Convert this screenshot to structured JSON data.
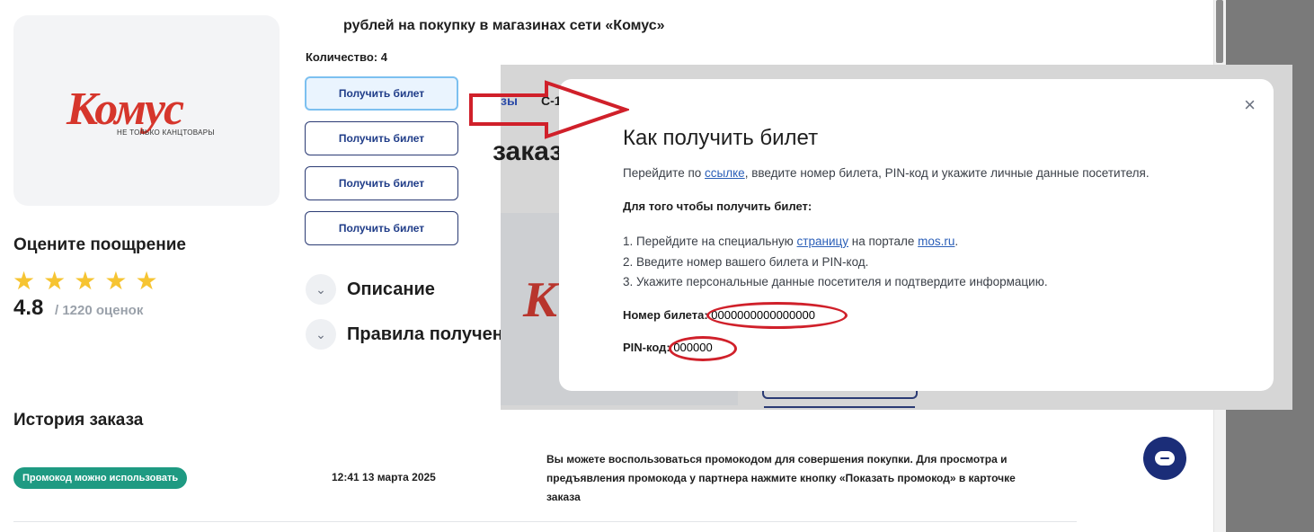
{
  "brand": {
    "logo_word": "Комус",
    "logo_tagline": "НЕ ТОЛЬКО КАНЦТОВАРЫ",
    "color": "#d6362c"
  },
  "headline": "рублей на покупку в магазинах сети «Комус»",
  "quantity_label": "Количество: 4",
  "ticket_buttons": [
    "Получить билет",
    "Получить билет",
    "Получить билет",
    "Получить билет"
  ],
  "rating": {
    "title": "Оцените поощрение",
    "value": "4.8",
    "count": "/ 1220 оценок",
    "stars": 5
  },
  "sections": {
    "description": "Описание",
    "rules": "Правила получен"
  },
  "history": {
    "title": "История заказа",
    "badge": "Промокод можно использовать",
    "time": "12:41 13 марта 2025",
    "text": "Вы можете воспользоваться промокодом для совершения покупки. Для просмотра и предъявления промокода у партнера нажмите кнопку «Показать промокод» в карточке заказа"
  },
  "overlay": {
    "crumb_a": "зы",
    "crumb_b": "С-1",
    "title_fragment": "заказ",
    "logo_fragment": "К"
  },
  "modal": {
    "title": "Как получить билет",
    "lead_before": "Перейдите по ",
    "lead_link": "ссылке",
    "lead_after": ", введите номер билета, PIN-код и укажите личные данные посетителя.",
    "subtitle": "Для того чтобы получить билет:",
    "step1_before": "1. Перейдите на специальную ",
    "step1_link": "страницу",
    "step1_mid": " на портале ",
    "step1_link2": "mos.ru",
    "step1_after": ".",
    "step2": "2. Введите номер вашего билета и PIN-код.",
    "step3": "3. Укажите персональные данные посетителя и подтвердите информацию.",
    "ticket_label": "Номер билета: ",
    "ticket_value": "0000000000000000",
    "pin_label": "PIN-код: ",
    "pin_value": "000000",
    "close_glyph": "×"
  },
  "colors": {
    "accent": "#1b2d78",
    "annotation": "#d0202a",
    "badge": "#1e9a82",
    "star": "#f6c432"
  },
  "icons": {
    "close": "close-icon",
    "chevron": "chevron-down-icon",
    "chat": "chat-icon",
    "star": "star-icon"
  }
}
